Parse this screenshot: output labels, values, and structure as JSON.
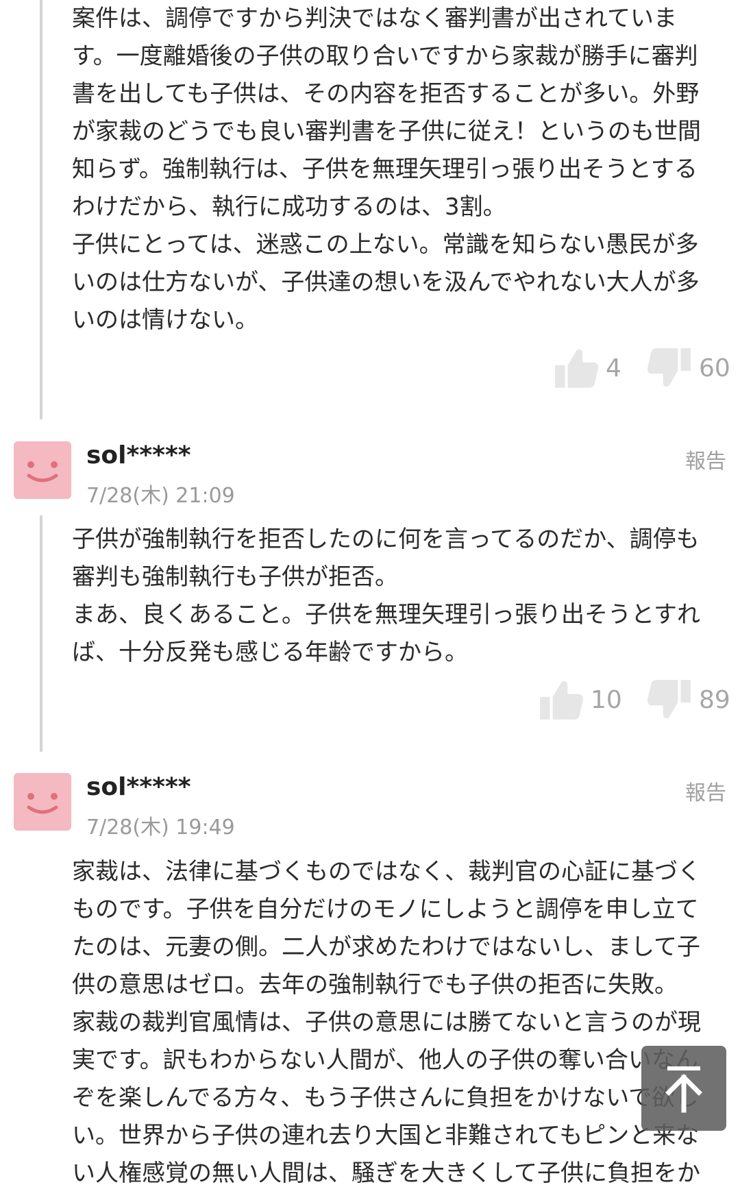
{
  "comments": [
    {
      "text": "案件は、調停ですから判決ではなく審判書が出されていま\nす。一度離婚後の子供の取り合いですから家裁が勝手に審判\n書を出しても子供は、その内容を拒否することが多い。外野\nが家裁のどうでも良い審判書を子供に従え！というのも世間\n知らず。強制執行は、子供を無理矢理引っ張り出そうとする\nわけだから、執行に成功するのは、3割。\n子供にとっては、迷惑この上ない。常識を知らない愚民が多\nいのは仕方ないが、子供達の想いを汲んでやれない大人が多\nいのは情けない。",
      "likes": "4",
      "dislikes": "60"
    },
    {
      "username": "sol*****",
      "timestamp": "7/28(木) 21:09",
      "report": "報告",
      "text": "子供が強制執行を拒否したのに何を言ってるのだか、調停も\n審判も強制執行も子供が拒否。\nまあ、良くあること。子供を無理矢理引っ張り出そうとすれ\nば、十分反発も感じる年齢ですから。",
      "likes": "10",
      "dislikes": "89"
    },
    {
      "username": "sol*****",
      "timestamp": "7/28(木) 19:49",
      "report": "報告",
      "text": "家裁は、法律に基づくものではなく、裁判官の心証に基づく\nものです。子供を自分だけのモノにしようと調停を申し立て\nたのは、元妻の側。二人が求めたわけではないし、まして子\n供の意思はゼロ。去年の強制執行でも子供の拒否に失敗。\n家裁の裁判官風情は、子供の意思には勝てないと言うのが現\n実です。訳もわからない人間が、他人の子供の奪い合いなん\nぞを楽しんでる方々、もう子供さんに負担をかけないで欲し\nい。世界から子供の連れ去り大国と非難されてもピンと来な\nい人権感覚の無い人間は、騒ぎを大きくして子供に負担をか"
    }
  ],
  "icons": {
    "like": "thumbs-up-icon",
    "dislike": "thumbs-down-icon",
    "avatar": "smiley-face-icon",
    "scroll_top": "arrow-up-icon"
  },
  "colors": {
    "avatar_bg": "#f4b9c1",
    "avatar_face": "#e0707c",
    "vote": "#a6a6a6",
    "reply_line": "#d4d4d4"
  }
}
